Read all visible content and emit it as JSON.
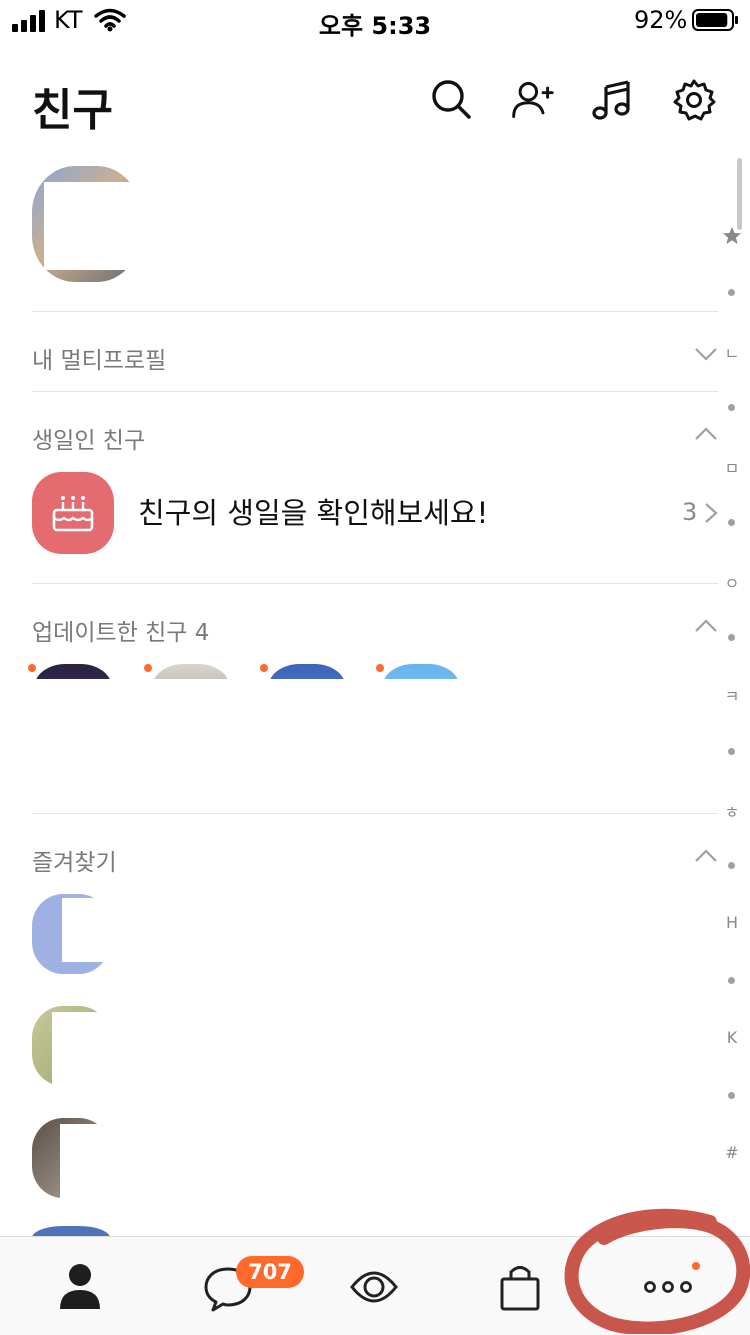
{
  "status_bar": {
    "carrier": "KT",
    "time": "오후 5:33",
    "battery_percent": "92%",
    "battery_level": 0.92,
    "signal_bars": 4
  },
  "header": {
    "title": "친구",
    "icons": [
      "search-icon",
      "add-friend-icon",
      "music-icon",
      "settings-icon"
    ]
  },
  "sections": {
    "multi_profile": {
      "label": "내 멀티프로필",
      "expanded": false
    },
    "birthday": {
      "label": "생일인 친구",
      "expanded": true,
      "item_text": "친구의 생일을 확인해보세요!",
      "count": "3"
    },
    "updated": {
      "label": "업데이트한 친구 4",
      "expanded": true
    },
    "favorites": {
      "label": "즐겨찾기",
      "expanded": true
    }
  },
  "index_bar": {
    "letters": [
      "ㄴ",
      "ㅁ",
      "ㅇ",
      "ㅋ",
      "ㅎ",
      "H",
      "K",
      "#"
    ]
  },
  "tab_bar": {
    "tabs": [
      "friends-tab",
      "chats-tab",
      "view-tab",
      "shopping-tab",
      "more-tab"
    ],
    "chat_badge": "707",
    "accent_color": "#ff6a2c"
  },
  "colors": {
    "birthday_icon_bg": "#e46b6f",
    "annotation_red": "#c0392b"
  }
}
